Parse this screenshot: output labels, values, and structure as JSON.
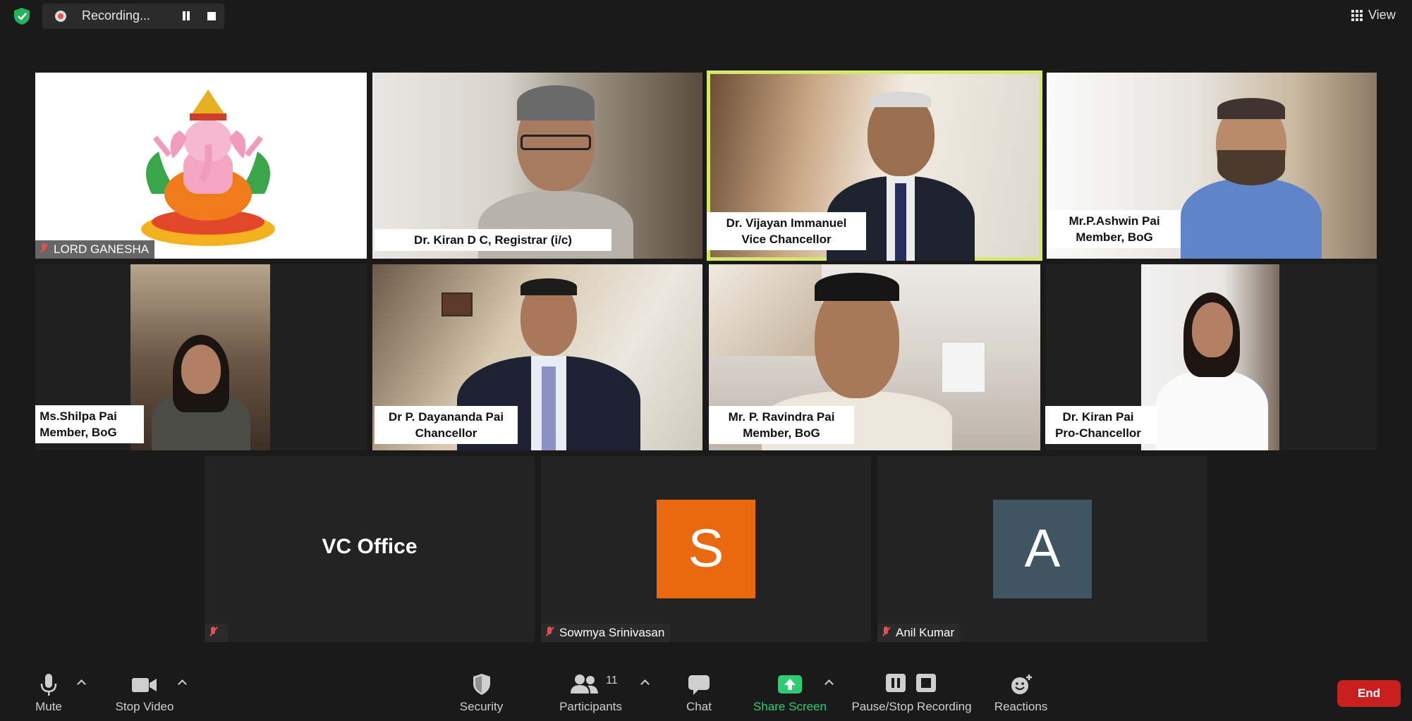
{
  "top": {
    "recording_label": "Recording...",
    "view_label": "View"
  },
  "tiles": {
    "ganesha": {
      "name": "LORD GANESHA"
    },
    "kiran_dc": {
      "caption": "Dr. Kiran D C, Registrar (i/c)"
    },
    "vijayan": {
      "line1": "Dr. Vijayan Immanuel",
      "line2": "Vice Chancellor"
    },
    "ashwin": {
      "line1": "Mr.P.Ashwin Pai",
      "line2": "Member, BoG"
    },
    "shilpa": {
      "line1": "Ms.Shilpa Pai",
      "line2": "Member, BoG"
    },
    "dayananda": {
      "line1": "Dr P. Dayananda Pai",
      "line2": "Chancellor"
    },
    "ravindra": {
      "line1": "Mr. P. Ravindra Pai",
      "line2": "Member, BoG"
    },
    "kiran_pai": {
      "line1": "Dr. Kiran Pai",
      "line2": "Pro-Chancellor"
    },
    "vc_office": {
      "display_name": "VC Office"
    },
    "sowmya": {
      "initial": "S",
      "name": "Sowmya Srinivasan",
      "avatar_color": "#e8690f"
    },
    "anil": {
      "initial": "A",
      "name": "Anil Kumar",
      "avatar_color": "#3f5561"
    }
  },
  "toolbar": {
    "mute": "Mute",
    "stop_video": "Stop Video",
    "security": "Security",
    "participants": "Participants",
    "participants_count": "11",
    "chat": "Chat",
    "share_screen": "Share Screen",
    "pause_stop_recording": "Pause/Stop Recording",
    "reactions": "Reactions",
    "end": "End"
  },
  "colors": {
    "background": "#1a1a1a",
    "active_speaker_border": "#d6e86b",
    "share_green": "#2ecc71",
    "end_red": "#c8201f"
  },
  "icons": [
    "shield-icon",
    "recording-dot-icon",
    "pause-icon",
    "stop-icon",
    "grid-view-icon",
    "microphone-icon",
    "video-camera-icon",
    "security-shield-icon",
    "participants-icon",
    "chat-icon",
    "share-screen-icon",
    "pause-recording-icon",
    "stop-recording-icon",
    "reactions-icon",
    "muted-mic-icon",
    "chevron-up-icon"
  ]
}
